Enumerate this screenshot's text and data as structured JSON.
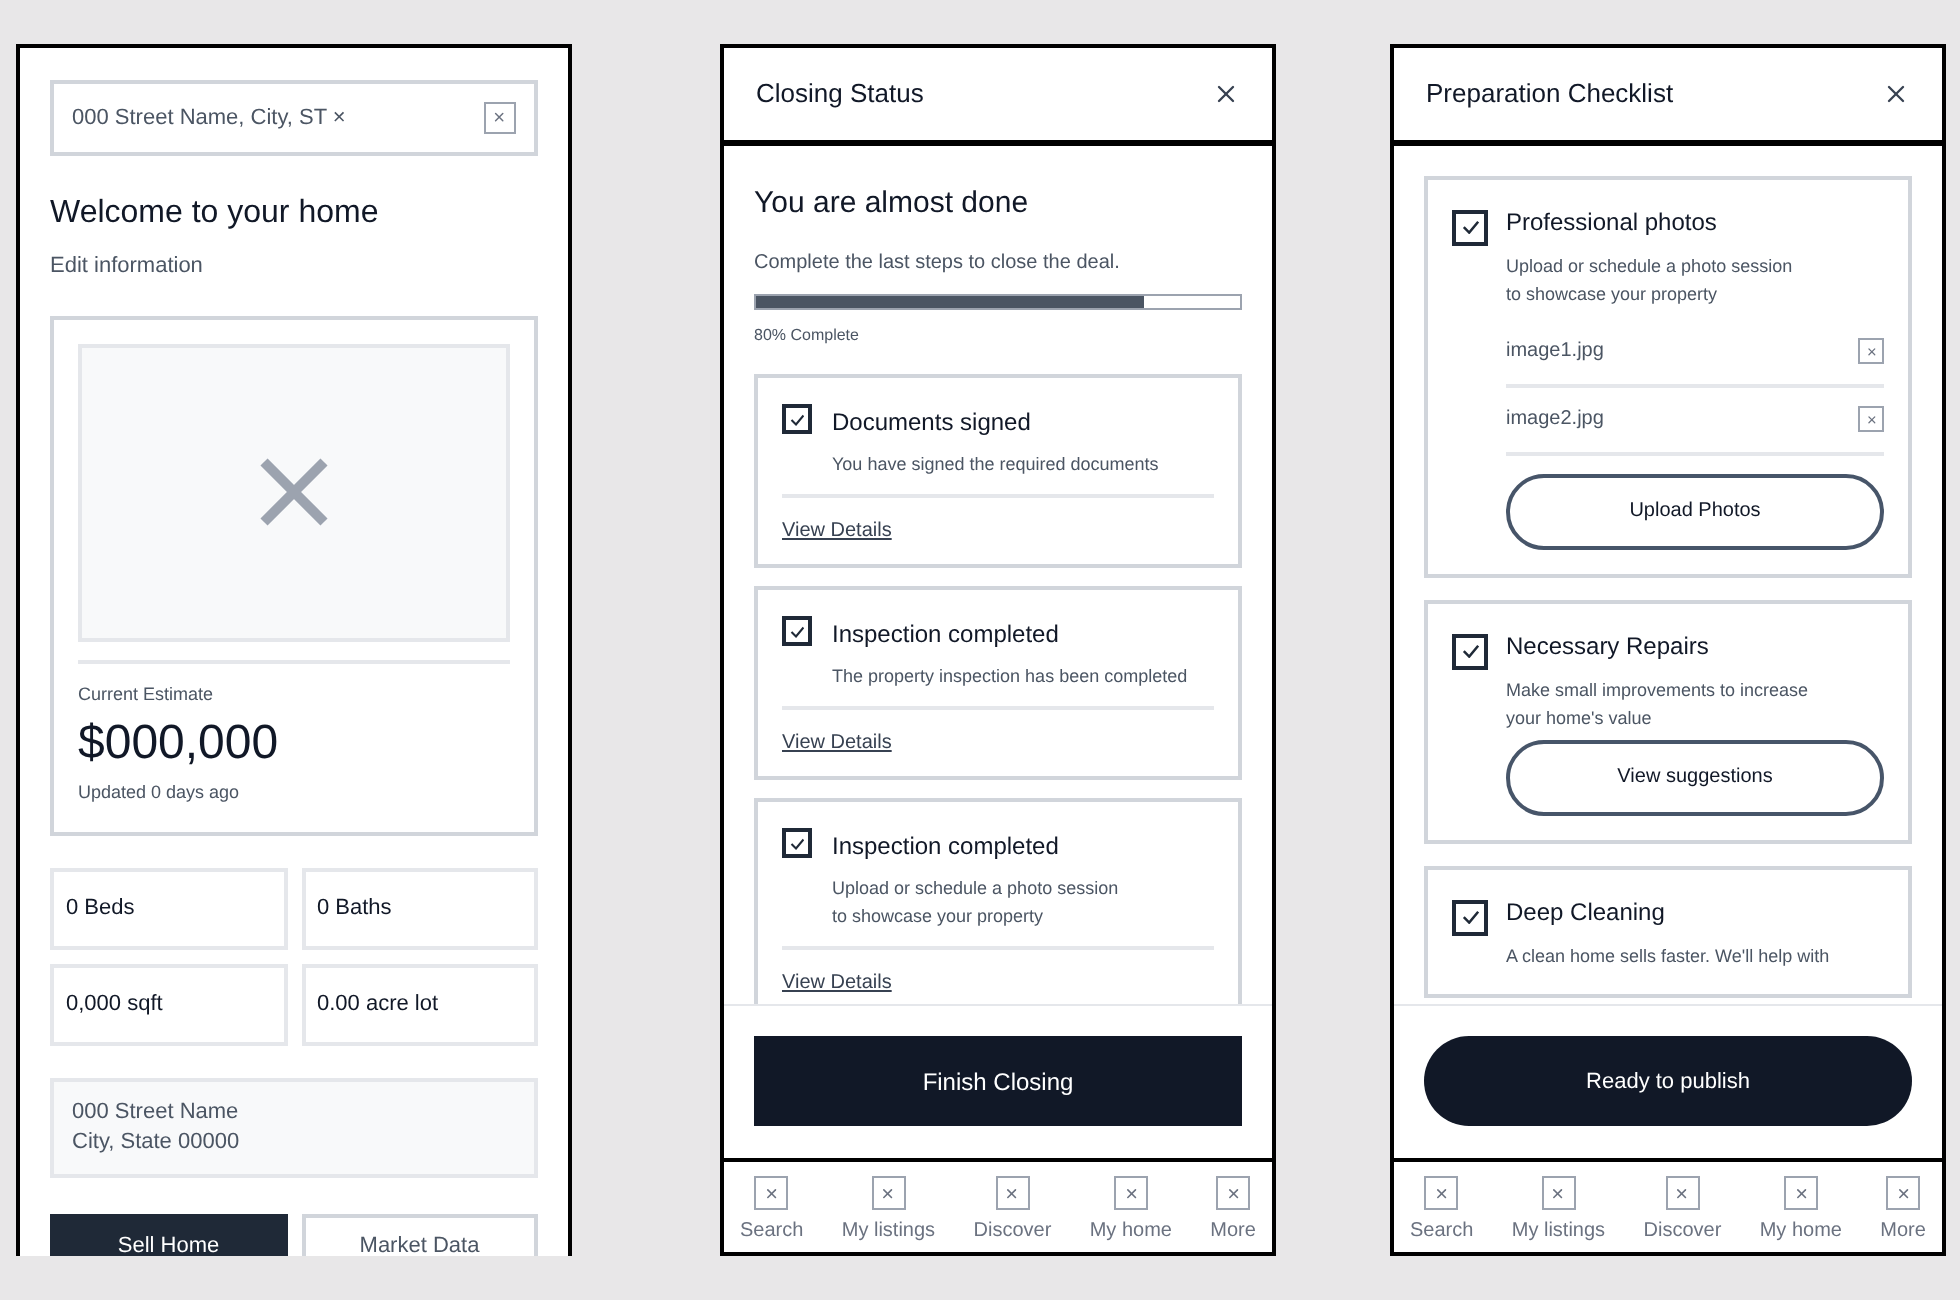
{
  "home": {
    "search": {
      "value": "000 Street Name, City, ST ×"
    },
    "title": "Welcome to your home",
    "edit_link": "Edit information",
    "estimate": {
      "label": "Current Estimate",
      "value": "$000,000",
      "updated": "Updated 0 days ago"
    },
    "facts": [
      "0 Beds",
      "0 Baths",
      "0,000 sqft",
      "0.00 acre lot"
    ],
    "address": [
      "000 Street Name",
      "City, State 00000"
    ],
    "actions": [
      {
        "label": "Sell Home",
        "primary": true
      },
      {
        "label": "Market Data",
        "primary": false
      }
    ]
  },
  "closing": {
    "title": "Closing Status",
    "heading": "You are almost done",
    "subtitle": "Complete the last steps to close the deal.",
    "progress": {
      "level": 0.8,
      "reading": "80% Complete"
    },
    "steps": [
      {
        "title": "Documents signed",
        "description": [
          "You have signed the required documents"
        ],
        "checked": true,
        "link": "View Details"
      },
      {
        "title": "Inspection completed",
        "description": [
          "The property inspection has been completed"
        ],
        "checked": true,
        "link": "View Details"
      },
      {
        "title": "Inspection completed",
        "description": [
          "Upload or schedule a photo session",
          "to showcase your property"
        ],
        "checked": true,
        "link": "View Details"
      }
    ],
    "button": "Finish Closing",
    "tab_bar": [
      "Search",
      "My listings",
      "Discover",
      "My home",
      "More"
    ]
  },
  "checklist": {
    "title": "Preparation Checklist",
    "items": [
      {
        "kind": "files",
        "title": "Professional photos",
        "description": [
          "Upload or schedule a photo session",
          "to showcase your property"
        ],
        "checked": true,
        "files": [
          "image1.jpg",
          "image2.jpg"
        ],
        "action": "Upload Photos"
      },
      {
        "kind": "button",
        "title": "Necessary Repairs",
        "description": [
          "Make small improvements to increase",
          "your home's value"
        ],
        "checked": true,
        "action": "View suggestions"
      },
      {
        "kind": "text",
        "title": "Deep Cleaning",
        "description": [
          "A clean home sells faster. We'll help with"
        ],
        "checked": true
      }
    ],
    "button": "Ready to publish",
    "tab_bar": [
      "Search",
      "My listings",
      "Discover",
      "My home",
      "More"
    ]
  }
}
